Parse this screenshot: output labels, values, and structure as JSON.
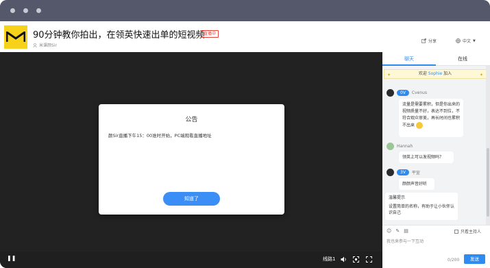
{
  "window": {
    "dots": 3
  },
  "header": {
    "title": "90分钟教你拍出，在领英快速出单的短视频",
    "live_badge": "直播中",
    "host": "米课颜Sir",
    "share": "分享",
    "language": "中文"
  },
  "announcement": {
    "title": "公告",
    "body": "颜Sir直播下午15：00准时开始，PC端观看直播地址",
    "button": "知道了"
  },
  "player_controls": {
    "line": "线路1"
  },
  "sidebar": {
    "tabs": [
      "聊天",
      "在线"
    ],
    "welcome_prefix": "欢迎",
    "welcome_name": "Sophie",
    "welcome_suffix": "加入",
    "messages": [
      {
        "badge": "0V",
        "name": "Cvenus",
        "text": "流量是需要累积，但是你出来的视频质量不好，表达不到位，不符合观众审美，再长时间也累积不出来"
      },
      {
        "name": "Hannah",
        "text": "领英上可以发视频吗？"
      },
      {
        "badge": "3V",
        "name": "平宣",
        "text": "颜颜声音好听"
      }
    ],
    "tip_title": "温馨提示",
    "tip_text": "设置简单的名称，有助于让小伙伴认识自己",
    "host_only": "只看主持人",
    "input_placeholder": "我也来参与一下互动",
    "counter": "0/200",
    "send": "发送"
  },
  "colors": {
    "accent": "#2e8cf0",
    "logo": "#f6d21a",
    "live": "#e8433b"
  }
}
